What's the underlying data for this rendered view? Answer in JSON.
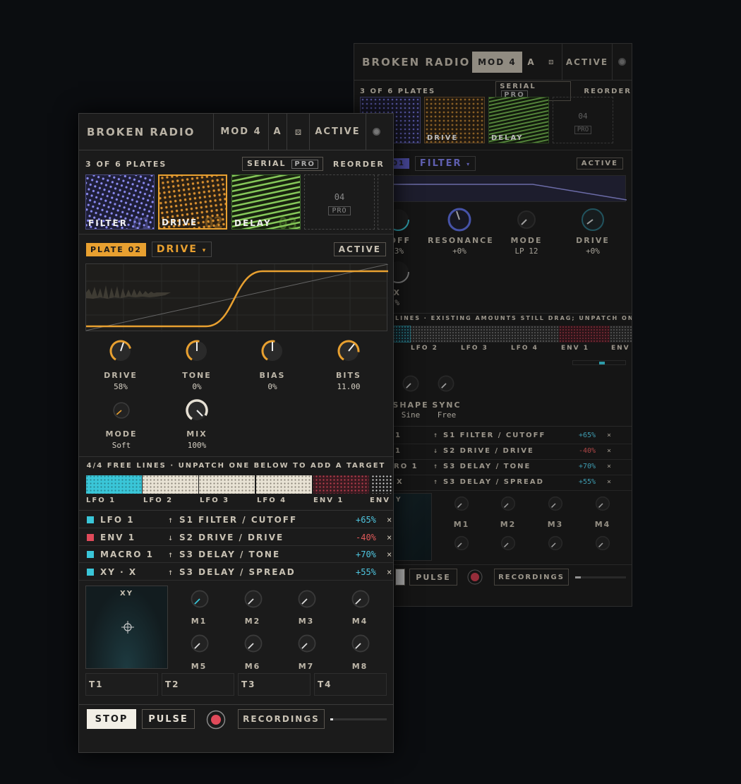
{
  "front": {
    "title": "BROKEN RADIO",
    "mod_label": "MOD 4",
    "a_label": "A",
    "active_label": "ACTIVE",
    "plates_count": "3 OF 6 PLATES",
    "serial_label": "SERIAL",
    "pro_label": "PRO",
    "reorder_label": "REORDER",
    "plates": [
      {
        "name": "FILTER",
        "num": "01",
        "color": "#8a8af0"
      },
      {
        "name": "DRIVE",
        "num": "02",
        "color": "#e8a030"
      },
      {
        "name": "DELAY",
        "num": "03",
        "color": "#7cc24a"
      }
    ],
    "empty_plate": {
      "num": "04",
      "pro": "PRO"
    },
    "plate_tag": "PLATE 02",
    "plate_select": "DRIVE",
    "plate_active": "ACTIVE",
    "knobs": [
      {
        "label": "DRIVE",
        "value": "58%"
      },
      {
        "label": "TONE",
        "value": "0%"
      },
      {
        "label": "BIAS",
        "value": "0%"
      },
      {
        "label": "BITS",
        "value": "11.00"
      },
      {
        "label": "MODE",
        "value": "Soft"
      },
      {
        "label": "MIX",
        "value": "100%"
      }
    ],
    "free_lines": "4/4 FREE LINES · UNPATCH ONE BELOW TO ADD A TARGET",
    "sources": [
      "LFO 1",
      "LFO 2",
      "LFO 3",
      "LFO 4",
      "ENV 1",
      "ENV"
    ],
    "routes": [
      {
        "src": "LFO 1",
        "dir": "↑",
        "target": "S1 FILTER / CUTOFF",
        "amount": "+65%",
        "color": "#3ac6d8",
        "amount_color": "#4fc6e0"
      },
      {
        "src": "ENV 1",
        "dir": "↓",
        "target": "S2 DRIVE / DRIVE",
        "amount": "-40%",
        "color": "#e04a5a",
        "amount_color": "#e05a5a"
      },
      {
        "src": "MACRO 1",
        "dir": "↑",
        "target": "S3 DELAY / TONE",
        "amount": "+70%",
        "color": "#3ac6d8",
        "amount_color": "#4fc6e0"
      },
      {
        "src": "XY · X",
        "dir": "↑",
        "target": "S3 DELAY / SPREAD",
        "amount": "+55%",
        "color": "#3ac6d8",
        "amount_color": "#4fc6e0"
      }
    ],
    "remove": "×",
    "xy_label": "XY",
    "macros": [
      "M1",
      "M2",
      "M3",
      "M4",
      "M5",
      "M6",
      "M7",
      "M8"
    ],
    "tracks": [
      "T1",
      "T2",
      "T3",
      "T4"
    ],
    "stop_label": "STOP",
    "pulse_label": "PULSE",
    "recordings_label": "RECORDINGS"
  },
  "back": {
    "title": "BROKEN RADIO",
    "mod_label": "MOD 4",
    "a_label": "A",
    "active_label": "ACTIVE",
    "plates_count": "3 OF 6 PLATES",
    "serial_label": "SERIAL",
    "pro_label": "PRO",
    "reorder_label": "REORDER",
    "plates": [
      {
        "name": "",
        "color": "#7070d0"
      },
      {
        "name": "DRIVE",
        "color": "#d89030"
      },
      {
        "name": "DELAY",
        "color": "#7cc24a"
      }
    ],
    "empty_plate": {
      "num": "04",
      "pro": "PRO"
    },
    "plate_tag": "01",
    "plate_select": "FILTER",
    "plate_active": "ACTIVE",
    "knobs": [
      {
        "label": "OFF",
        "value": "3%"
      },
      {
        "label": "RESONANCE",
        "value": "+0%"
      },
      {
        "label": "MODE",
        "value": "LP 12"
      },
      {
        "label": "DRIVE",
        "value": "+0%"
      },
      {
        "label": "X",
        "value": "%"
      },
      {
        "label": "SHAPE",
        "value": "Sine"
      },
      {
        "label": "SYNC",
        "value": "Free"
      }
    ],
    "free_lines": "LINES · EXISTING AMOUNTS STILL DRAG; UNPATCH ONE BEL…",
    "sources": [
      "LFO 2",
      "LFO 3",
      "LFO 4",
      "ENV 1",
      "ENV"
    ],
    "routes": [
      {
        "src": "1",
        "dir": "↑",
        "target": "S1 FILTER / CUTOFF",
        "amount": "+65%",
        "amount_color": "#4fc6e0"
      },
      {
        "src": "1",
        "dir": "↓",
        "target": "S2 DRIVE / DRIVE",
        "amount": "-40%",
        "amount_color": "#e05a5a"
      },
      {
        "src": "RO 1",
        "dir": "↑",
        "target": "S3 DELAY / TONE",
        "amount": "+70%",
        "amount_color": "#4fc6e0"
      },
      {
        "src": "X",
        "dir": "↑",
        "target": "S3 DELAY / SPREAD",
        "amount": "+55%",
        "amount_color": "#4fc6e0"
      }
    ],
    "remove": "×",
    "xy_label": "Y",
    "macros": [
      "M1",
      "M2",
      "M3",
      "M4"
    ],
    "pulse_label": "PULSE",
    "recordings_label": "RECORDINGS"
  },
  "colors": {
    "accent": "#e8a030",
    "cyan": "#3ac6d8",
    "red": "#e04a5a"
  }
}
